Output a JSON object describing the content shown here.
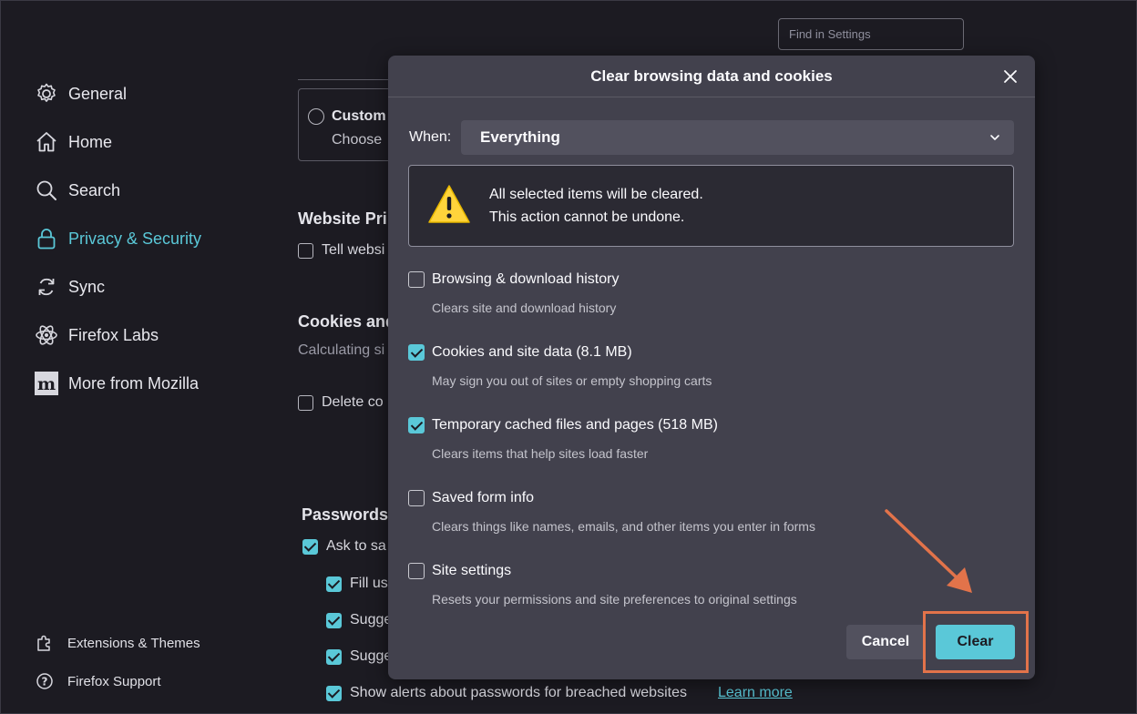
{
  "search": {
    "placeholder": "Find in Settings"
  },
  "sidebar": {
    "items": [
      {
        "label": "General",
        "icon": "gear-icon"
      },
      {
        "label": "Home",
        "icon": "home-icon"
      },
      {
        "label": "Search",
        "icon": "search-icon"
      },
      {
        "label": "Privacy & Security",
        "icon": "lock-icon",
        "active": true
      },
      {
        "label": "Sync",
        "icon": "sync-icon"
      },
      {
        "label": "Firefox Labs",
        "icon": "labs-icon"
      },
      {
        "label": "More from Mozilla",
        "icon": "mozilla-icon"
      }
    ],
    "footer": [
      {
        "label": "Extensions & Themes",
        "icon": "puzzle-icon"
      },
      {
        "label": "Firefox Support",
        "icon": "help-icon"
      }
    ]
  },
  "background": {
    "custom_title": "Custom",
    "custom_sub": "Choose",
    "website_privacy_heading": "Website Pri",
    "tell_websites": "Tell websi",
    "cookies_heading": "Cookies and",
    "calculating": "Calculating si",
    "delete_cookies": "Delete co",
    "passwords_heading": "Passwords",
    "ask_to_save": "Ask to sa",
    "fill_usernames": "Fill us",
    "suggest_1": "Sugge",
    "suggest_2": "Sugge",
    "breach_alerts": "Show alerts about passwords for breached websites",
    "learn_more": "Learn more"
  },
  "dialog": {
    "title": "Clear browsing data and cookies",
    "when_label": "When:",
    "when_value": "Everything",
    "warning_line1": "All selected items will be cleared.",
    "warning_line2": "This action cannot be undone.",
    "options": [
      {
        "label": "Browsing & download history",
        "desc": "Clears site and download history",
        "checked": false
      },
      {
        "label": "Cookies and site data (8.1 MB)",
        "desc": "May sign you out of sites or empty shopping carts",
        "checked": true
      },
      {
        "label": "Temporary cached files and pages (518 MB)",
        "desc": "Clears items that help sites load faster",
        "checked": true
      },
      {
        "label": "Saved form info",
        "desc": "Clears things like names, emails, and other items you enter in forms",
        "checked": false
      },
      {
        "label": "Site settings",
        "desc": "Resets your permissions and site preferences to original settings",
        "checked": false
      }
    ],
    "cancel_label": "Cancel",
    "clear_label": "Clear"
  },
  "colors": {
    "accent": "#5ac8d8",
    "annotation": "#e2734a",
    "dialog_bg": "#42414d",
    "page_bg": "#1c1b22"
  }
}
